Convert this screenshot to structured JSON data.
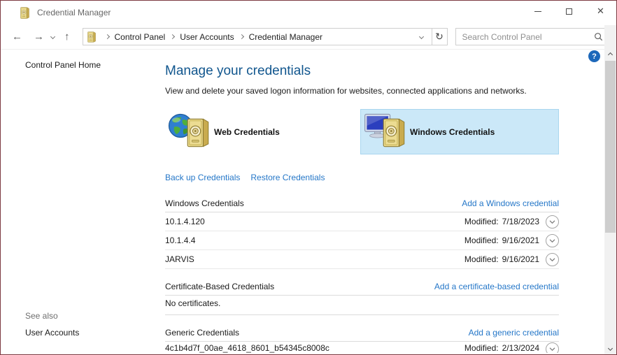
{
  "window": {
    "title": "Credential Manager",
    "icons": {
      "back": "←",
      "forward": "→",
      "up": "↑",
      "refresh": "↻",
      "close": "✕",
      "help": "?"
    }
  },
  "navbar": {
    "crumbs": [
      "Control Panel",
      "User Accounts",
      "Credential Manager"
    ],
    "search_placeholder": "Search Control Panel"
  },
  "sidebar": {
    "home_label": "Control Panel Home",
    "see_also_label": "See also",
    "user_accounts_label": "User Accounts"
  },
  "main": {
    "heading": "Manage your credentials",
    "description": "View and delete your saved logon information for websites, connected applications and networks.",
    "tabs": [
      {
        "label": "Web Credentials",
        "selected": false
      },
      {
        "label": "Windows Credentials",
        "selected": true
      }
    ],
    "backup_link": "Back up Credentials",
    "restore_link": "Restore Credentials",
    "modified_label": "Modified:",
    "windows_section": {
      "title": "Windows Credentials",
      "add_link": "Add a Windows credential",
      "rows": [
        {
          "name": "10.1.4.120",
          "modified": "7/18/2023"
        },
        {
          "name": "10.1.4.4",
          "modified": "9/16/2021"
        },
        {
          "name": "JARVIS",
          "modified": "9/16/2021"
        }
      ]
    },
    "certificate_section": {
      "title": "Certificate-Based Credentials",
      "add_link": "Add a certificate-based credential",
      "empty_text": "No certificates."
    },
    "generic_section": {
      "title": "Generic Credentials",
      "add_link": "Add a generic credential",
      "rows": [
        {
          "name": "4c1b4d7f_00ae_4618_8601_b54345c8008c",
          "modified": "2/13/2024"
        }
      ]
    }
  },
  "colors": {
    "window_border": "#7d3a42",
    "heading": "#11568e",
    "link": "#2577c8",
    "selected_tab_bg": "#cbe8f8",
    "selected_tab_border": "#a9d6ef",
    "help_icon_bg": "#1d68ba"
  }
}
